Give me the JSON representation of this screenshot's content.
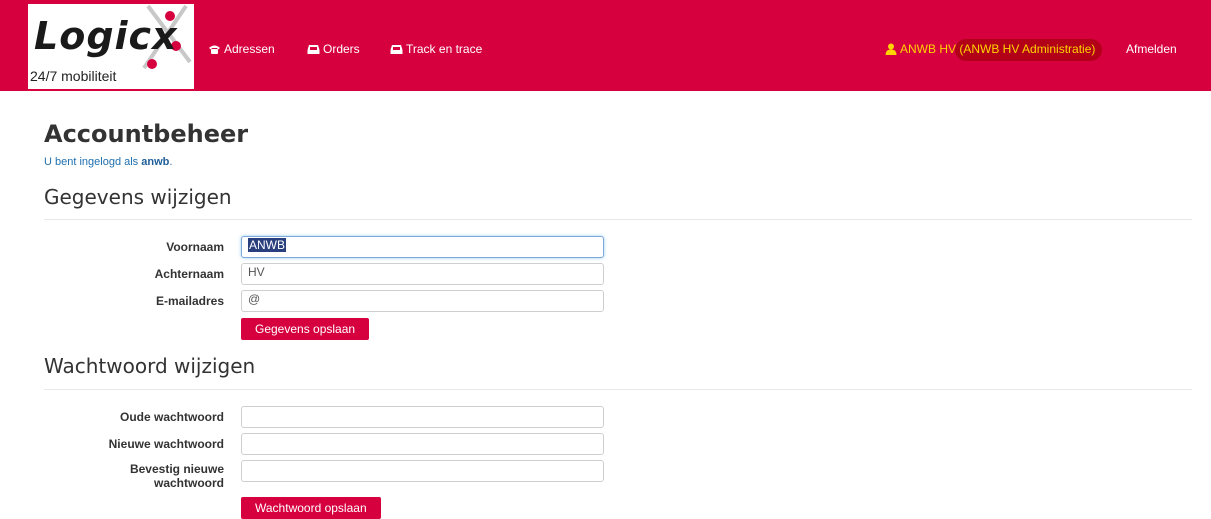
{
  "brand": {
    "name": "Logicx",
    "tagline": "24/7 mobiliteit"
  },
  "nav": {
    "items": [
      {
        "label": "Adressen",
        "icon": "phone-icon"
      },
      {
        "label": "Orders",
        "icon": "inbox-icon"
      },
      {
        "label": "Track en trace",
        "icon": "inbox-icon"
      }
    ],
    "user": {
      "label": "ANWB HV (ANWB HV Administratie)",
      "icon": "user-icon"
    },
    "logout": "Afmelden"
  },
  "page": {
    "title": "Accountbeheer",
    "login_prefix": "U bent ingelogd als ",
    "login_user": "anwb",
    "login_suffix": "."
  },
  "details": {
    "heading": "Gegevens wijzigen",
    "firstname_label": "Voornaam",
    "firstname_value": "ANWB",
    "lastname_label": "Achternaam",
    "lastname_value": "HV",
    "email_label": "E-mailadres",
    "email_value": "@",
    "save": "Gegevens opslaan"
  },
  "password": {
    "heading": "Wachtwoord wijzigen",
    "old_label": "Oude wachtwoord",
    "new_label": "Nieuwe wachtwoord",
    "confirm_label": "Bevestig nieuwe wachtwoord",
    "save": "Wachtwoord opslaan"
  },
  "colors": {
    "brand": "#d6003f",
    "user": "#ffd400",
    "link": "#1f6fae"
  }
}
